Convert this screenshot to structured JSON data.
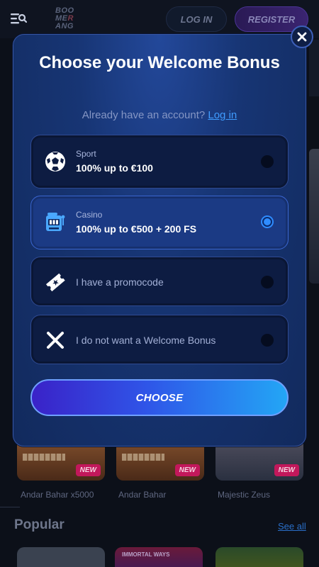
{
  "header": {
    "logo_lines": [
      "BOO",
      "ME",
      "ANG"
    ],
    "logo_mark": "R",
    "login_label": "LOG IN",
    "register_label": "REGISTER"
  },
  "modal": {
    "title": "Choose your Welcome Bonus",
    "account_prompt": "Already have an account?",
    "login_link": "Log in",
    "options": [
      {
        "icon": "soccer-ball-icon",
        "category": "Sport",
        "text": "100% up to €100",
        "selected": false
      },
      {
        "icon": "slot-machine-icon",
        "category": "Casino",
        "text": "100% up to €500 + 200 FS",
        "selected": true
      },
      {
        "icon": "ticket-icon",
        "category": "",
        "text": "I have a promocode",
        "selected": false
      },
      {
        "icon": "close-x-icon",
        "category": "",
        "text": "I do not want a Welcome Bonus",
        "selected": false
      }
    ],
    "choose_label": "CHOOSE",
    "close_icon": "close-icon"
  },
  "background": {
    "games": [
      {
        "name": "Andar Bahar x5000",
        "badge": "NEW"
      },
      {
        "name": "Andar Bahar",
        "badge": "NEW"
      },
      {
        "name": "Majestic Zeus",
        "badge": "NEW"
      }
    ],
    "section_title": "Popular",
    "see_all": "See all",
    "popular_tag": "IMMORTAL WAYS"
  }
}
